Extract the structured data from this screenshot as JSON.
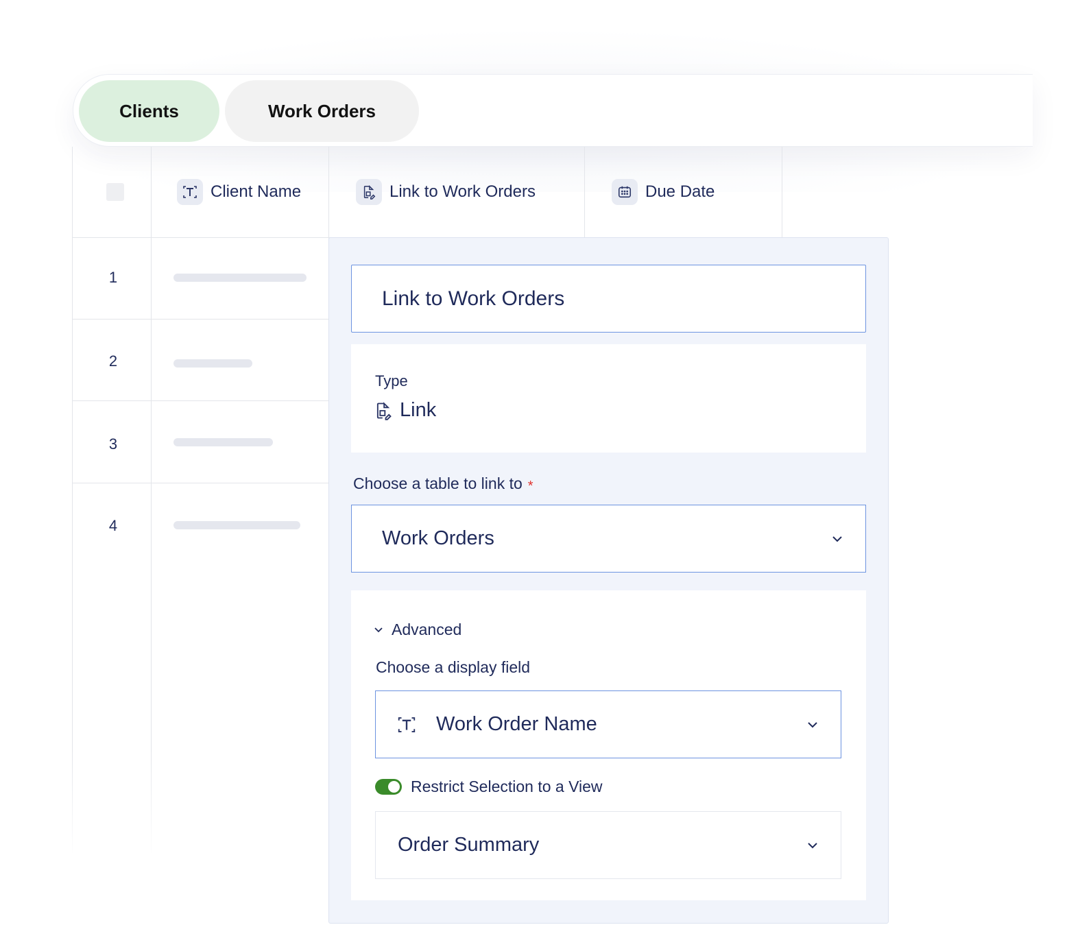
{
  "tabs": [
    {
      "label": "Clients",
      "active": true,
      "color": "#dcf0de"
    },
    {
      "label": "Work Orders",
      "active": false,
      "color": "#f2f2f2"
    }
  ],
  "table": {
    "columns": [
      {
        "label": "Client Name",
        "icon": "text-field-icon"
      },
      {
        "label": "Link to Work Orders",
        "icon": "link-record-icon"
      },
      {
        "label": "Due Date",
        "icon": "calendar-icon"
      }
    ],
    "rows": [
      "1",
      "2",
      "3",
      "4"
    ]
  },
  "panel": {
    "field_name": "Link to Work Orders",
    "type_label": "Type",
    "type_value": "Link",
    "choose_table_label": "Choose a table to link to",
    "required_mark": "*",
    "selected_table": "Work Orders",
    "advanced_label": "Advanced",
    "display_field_label": "Choose a display field",
    "selected_display_field": "Work Order Name",
    "restrict_label": "Restrict Selection to a View",
    "restrict_enabled": true,
    "selected_view": "Order Summary"
  },
  "colors": {
    "accent_border": "#6c93e0",
    "text": "#1f2a5a",
    "toggle_on": "#3a8b2a",
    "required": "#e0332e",
    "panel_bg": "#f1f4fb"
  }
}
